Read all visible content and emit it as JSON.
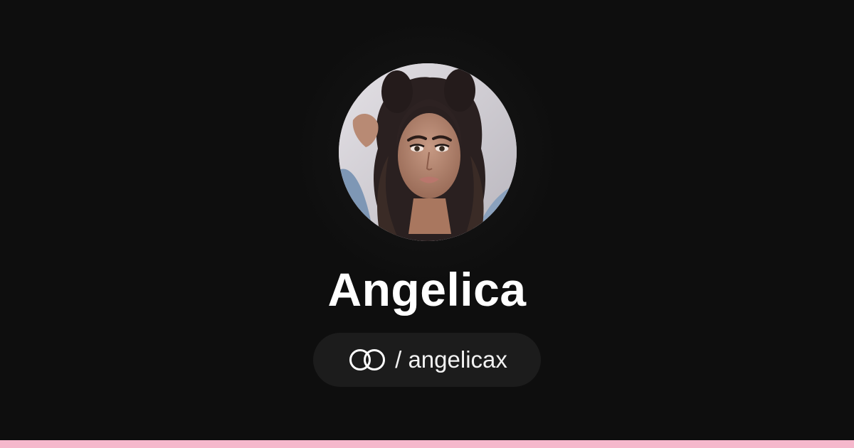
{
  "profile": {
    "display_name": "Angelica",
    "avatar_alt": "Angelica",
    "avatar_icon": "profile-photo"
  },
  "handle": {
    "separator": "/",
    "username": "angelicax",
    "text": "/ angelicax",
    "icon": "linked-rings-icon"
  },
  "colors": {
    "background": "#0e0e0e",
    "pill_background": "#1c1c1c",
    "text": "#ffffff",
    "accent_bar": "#f5b8cc"
  }
}
